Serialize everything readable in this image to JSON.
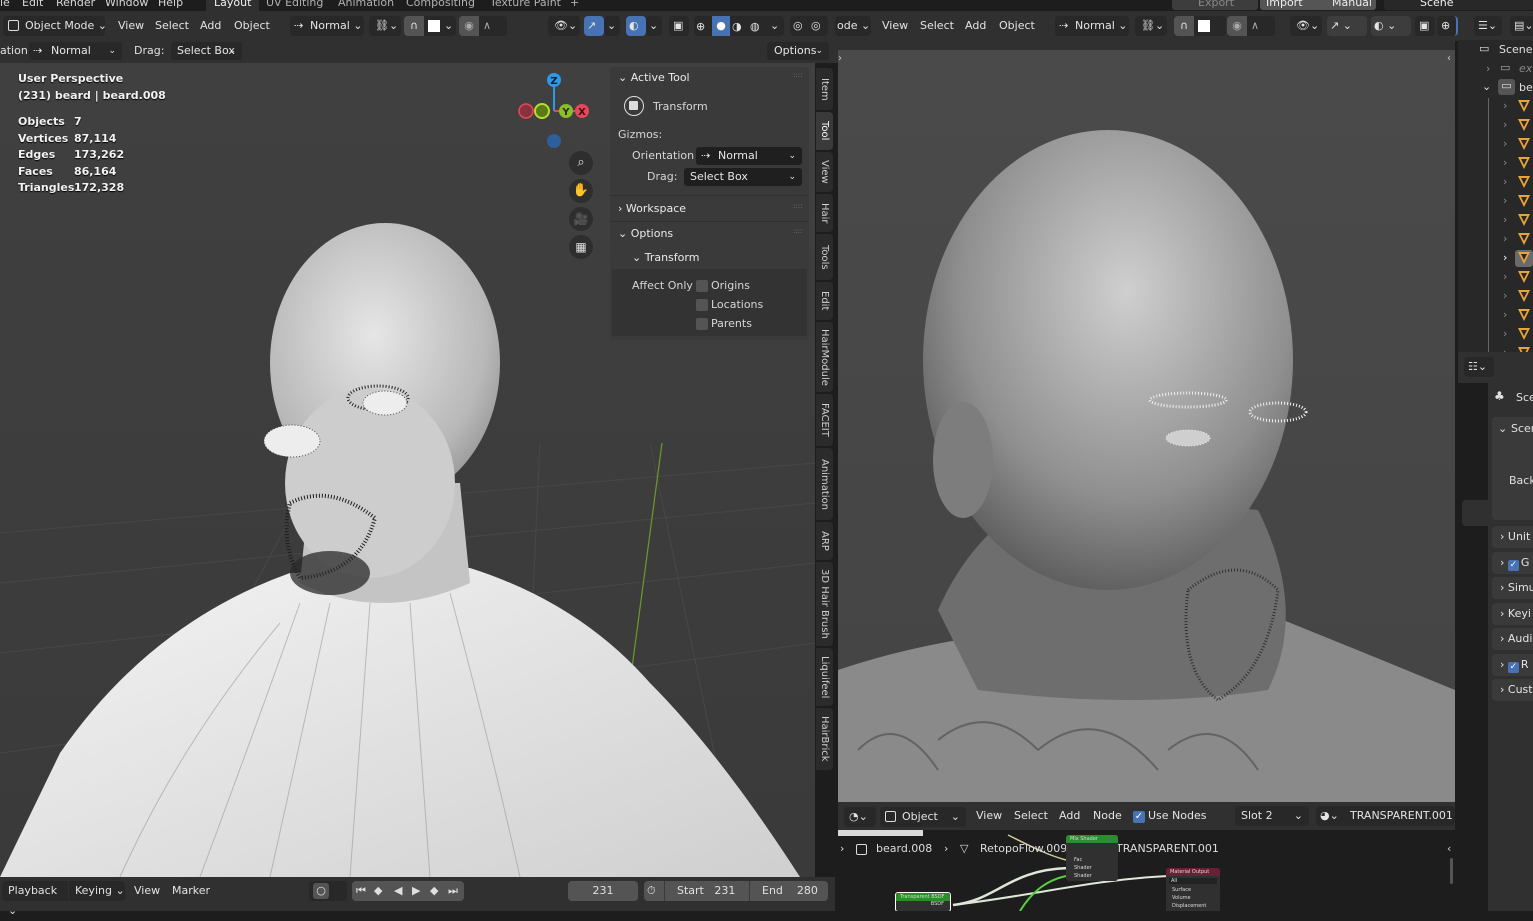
{
  "menu": {
    "items": [
      "File",
      "Edit",
      "Render",
      "Window",
      "Help"
    ],
    "workspaces": [
      "Layout",
      "UV Editing",
      "Animation",
      "Compositing",
      "Texture Paint"
    ],
    "active_workspace": "Layout",
    "add_tab": "+",
    "right_buttons": {
      "export": "Export",
      "import": "Import",
      "manual": "Manual",
      "scene": "Scene"
    }
  },
  "viewport_left": {
    "header": {
      "mode": "Object Mode",
      "view": "View",
      "select": "Select",
      "add": "Add",
      "object": "Object",
      "orientation": "Normal",
      "options": "Options"
    },
    "tool_settings": {
      "orientation_label": "ation:",
      "orientation": "Normal",
      "drag_label": "Drag:",
      "drag": "Select Box"
    },
    "overlay": {
      "perspective": "User Perspective",
      "object": "(231) beard | beard.008",
      "stats": [
        {
          "k": "Objects",
          "v": "7"
        },
        {
          "k": "Vertices",
          "v": "87,114"
        },
        {
          "k": "Edges",
          "v": "173,262"
        },
        {
          "k": "Faces",
          "v": "86,164"
        },
        {
          "k": "Triangles",
          "v": "172,328"
        }
      ]
    },
    "gizmo": {
      "z": "Z",
      "y": "Y",
      "x": "X"
    },
    "n_panel": {
      "active_tool": "Active Tool",
      "tool_name": "Transform",
      "gizmos": "Gizmos:",
      "orientation_label": "Orientation",
      "orientation": "Normal",
      "drag_label": "Drag:",
      "drag": "Select Box",
      "workspace": "Workspace",
      "options": "Options",
      "transform": "Transform",
      "affect_only": "Affect Only",
      "checkboxes": [
        {
          "label": "Origins",
          "checked": false
        },
        {
          "label": "Locations",
          "checked": false
        },
        {
          "label": "Parents",
          "checked": false
        }
      ]
    },
    "side_tabs": [
      "Item",
      "Tool",
      "View",
      "Hair",
      "Tools",
      "Edit",
      "HairModule",
      "FACEIT",
      "Animation",
      "ARP",
      "3D Hair Brush",
      "Liquifeel",
      "HairBrick"
    ]
  },
  "viewport_right": {
    "header": {
      "mode": "ode",
      "view": "View",
      "select": "Select",
      "add": "Add",
      "object": "Object",
      "orientation": "Normal"
    }
  },
  "timeline": {
    "playback": "Playback",
    "keying": "Keying",
    "view": "View",
    "marker": "Marker",
    "current_frame": "231",
    "start_label": "Start",
    "start": "231",
    "end_label": "End",
    "end": "280"
  },
  "node_editor": {
    "header": {
      "type": "Object",
      "view": "View",
      "select": "Select",
      "add": "Add",
      "node": "Node",
      "use_nodes": "Use Nodes",
      "use_nodes_checked": true,
      "slot": "Slot 2",
      "material": "TRANSPARENT.001"
    },
    "breadcrumb": [
      "beard.008",
      "RetopoFlow.009",
      "TRANSPARENT.001"
    ],
    "nodes": {
      "mix": {
        "title": "Mix Shader",
        "sockets": [
          "Fac",
          "Shader",
          "Shader"
        ]
      },
      "transparent": {
        "title": "Transparent BSDF",
        "out": "BSDF"
      },
      "output": {
        "title": "Material Output",
        "target": "All",
        "sockets": [
          "Surface",
          "Volume",
          "Displacement"
        ]
      }
    }
  },
  "outliner": {
    "scene": "Scene C",
    "collections": [
      {
        "label": "ext",
        "expanded": false
      },
      {
        "label": "bea",
        "expanded": true
      }
    ],
    "mesh_count": 14,
    "active_index": 8
  },
  "properties": {
    "title": "Sce",
    "scene_panel": "Scen",
    "background_label": "Back",
    "sections": [
      {
        "label": "Unit",
        "checkbox": false
      },
      {
        "label": "G",
        "checkbox": true
      },
      {
        "label": "Simu",
        "checkbox": false
      },
      {
        "label": "Keyi",
        "checkbox": false
      },
      {
        "label": "Audi",
        "checkbox": false
      },
      {
        "label": "R",
        "checkbox": true
      },
      {
        "label": "Cust",
        "checkbox": false
      }
    ]
  },
  "colors": {
    "accent": "#4772b3",
    "x_axis": "#e8475a",
    "y_axis": "#8bbf2a",
    "z_axis": "#2b9ae8",
    "mesh": "#e8a33a",
    "node_green": "#2d8c2d",
    "node_red": "#6b1f32"
  }
}
